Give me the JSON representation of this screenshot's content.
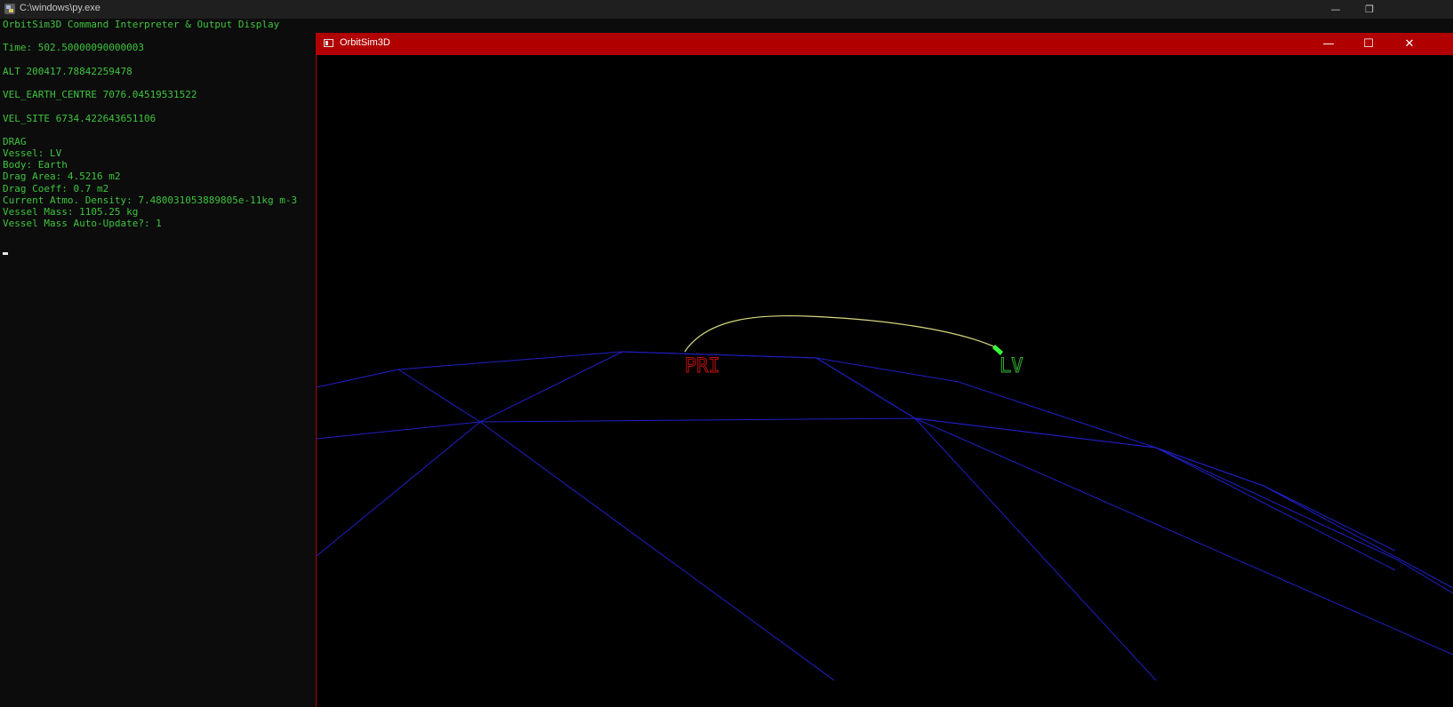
{
  "console": {
    "title": "C:\\windows\\py.exe",
    "minimize_label": "—",
    "restore_label": "❐",
    "lines": [
      "OrbitSim3D Command Interpreter & Output Display",
      "",
      "Time: 502.50000090000003",
      "",
      "ALT 200417.78842259478",
      "",
      "VEL_EARTH_CENTRE 7076.04519531522",
      "",
      "VEL_SITE 6734.422643651106",
      "",
      "DRAG",
      "Vessel: LV",
      "Body: Earth",
      "Drag Area: 4.5216 m2",
      "Drag Coeff: 0.7 m2",
      "Current Atmo. Density: 7.480031053889805e-11kg m-3",
      "Vessel Mass: 1105.25 kg",
      "Vessel Mass Auto-Update?: 1"
    ],
    "text_color": "#3ec43e"
  },
  "sim_window": {
    "title": "OrbitSim3D",
    "minimize_label": "—",
    "maximize_label": "☐",
    "close_label": "✕",
    "titlebar_color": "#b10000",
    "scene": {
      "site_label": "PRI",
      "site_label_color": "#c01010",
      "vessel_label": "LV",
      "vessel_label_color": "#30b030",
      "trajectory_color": "#d8d880",
      "planet_grid_color": "#2020c8"
    }
  }
}
